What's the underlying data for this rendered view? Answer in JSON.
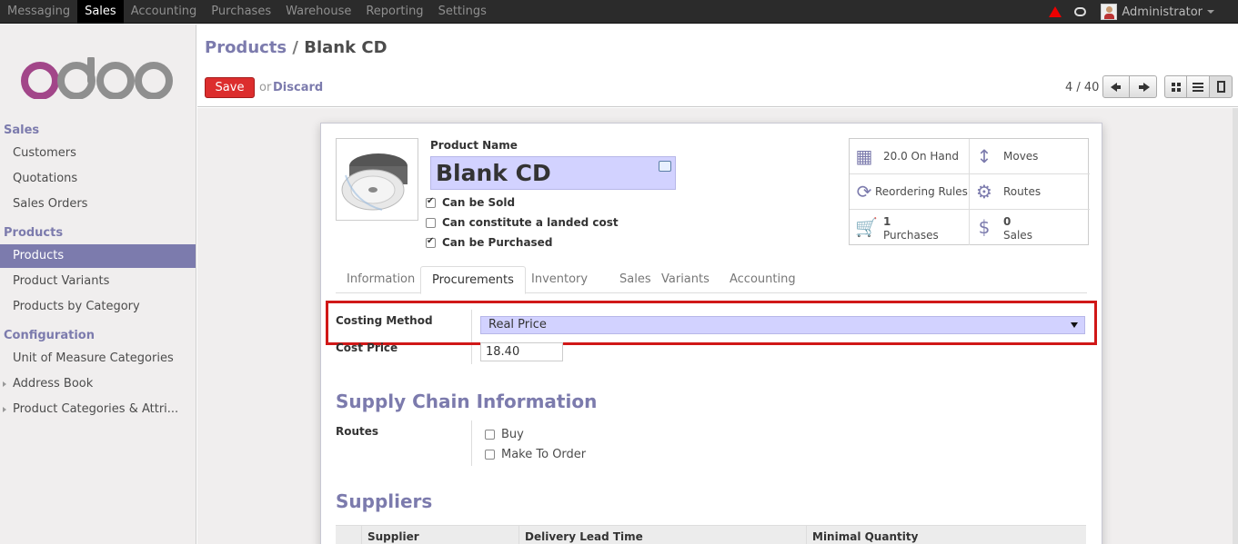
{
  "topbar": {
    "menu": [
      "Messaging",
      "Sales",
      "Accounting",
      "Purchases",
      "Warehouse",
      "Reporting",
      "Settings"
    ],
    "active_menu": "Sales",
    "user": "Administrator"
  },
  "sidebar": {
    "sections": [
      {
        "title": "Sales",
        "items": [
          "Customers",
          "Quotations",
          "Sales Orders"
        ]
      },
      {
        "title": "Products",
        "items": [
          "Products",
          "Product Variants",
          "Products by Category"
        ]
      },
      {
        "title": "Configuration",
        "items": [
          "Unit of Measure Categories",
          "Address Book",
          "Product Categories & Attri..."
        ]
      }
    ],
    "active_item": "Products"
  },
  "breadcrumb": {
    "parent": "Products",
    "separator": "/",
    "current": "Blank CD"
  },
  "toolbar": {
    "save_label": "Save",
    "or_label": "or",
    "discard_label": "Discard",
    "pager": "4 / 40"
  },
  "product": {
    "name_label": "Product Name",
    "name": "Blank CD",
    "checkboxes": [
      {
        "label": "Can be Sold",
        "checked": true
      },
      {
        "label": "Can constitute a landed cost",
        "checked": false
      },
      {
        "label": "Can be Purchased",
        "checked": true
      }
    ]
  },
  "smart_buttons": [
    {
      "icon": "building-icon",
      "text": "20.0 On Hand"
    },
    {
      "icon": "arrows-vertical-icon",
      "text": "Moves"
    },
    {
      "icon": "refresh-icon",
      "text": "Reordering Rules"
    },
    {
      "icon": "cogs-icon",
      "text": "Routes"
    },
    {
      "icon": "cart-icon",
      "count": "1",
      "text": "Purchases"
    },
    {
      "icon": "dollar-icon",
      "count": "0",
      "text": "Sales"
    }
  ],
  "tabs": [
    "Information",
    "Procurements",
    "Inventory",
    "Sales",
    "Variants",
    "Accounting"
  ],
  "active_tab": "Procurements",
  "procurements": {
    "costing_method_label": "Costing Method",
    "costing_method_value": "Real Price",
    "cost_price_label": "Cost Price",
    "cost_price_value": "18.40",
    "supply_chain_title": "Supply Chain Information",
    "routes_label": "Routes",
    "routes": [
      {
        "label": "Buy",
        "checked": false
      },
      {
        "label": "Make To Order",
        "checked": false
      }
    ],
    "suppliers_title": "Suppliers",
    "supplier_columns": [
      "Supplier",
      "Delivery Lead Time",
      "Minimal Quantity"
    ]
  },
  "colors": {
    "accent": "#7c7bad",
    "save": "#dc2d2d",
    "highlight": "#d01818"
  }
}
